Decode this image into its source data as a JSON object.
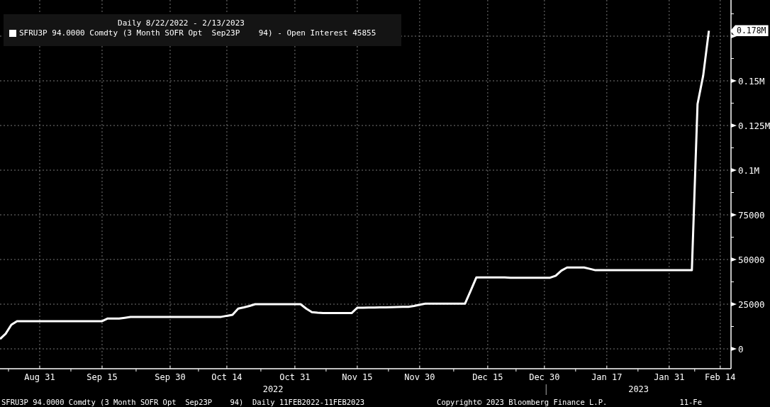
{
  "chart": {
    "chart_data": {
      "type": "line",
      "title": "Daily 8/22/2022 - 2/13/2023",
      "categories": [
        null,
        null,
        null,
        null,
        null,
        null,
        null,
        "Aug 31",
        null,
        null,
        null,
        null,
        null,
        null,
        null,
        null,
        null,
        null,
        "Sep 15",
        null,
        null,
        null,
        null,
        null,
        null,
        null,
        null,
        null,
        null,
        null,
        "Sep 30",
        null,
        null,
        null,
        null,
        null,
        null,
        null,
        null,
        null,
        "Oct 14",
        null,
        null,
        null,
        null,
        null,
        null,
        null,
        null,
        null,
        null,
        null,
        "Oct 31",
        null,
        null,
        null,
        null,
        null,
        null,
        null,
        null,
        null,
        null,
        "Nov 15",
        null,
        null,
        null,
        null,
        null,
        null,
        null,
        null,
        null,
        null,
        "Nov 30",
        null,
        null,
        null,
        null,
        null,
        null,
        null,
        null,
        null,
        null,
        null,
        "Dec 15",
        null,
        null,
        null,
        null,
        null,
        null,
        null,
        null,
        null,
        "Dec 30",
        null,
        null,
        null,
        null,
        null,
        null,
        null,
        null,
        null,
        null,
        "Jan 17",
        null,
        null,
        null,
        null,
        null,
        null,
        null,
        null,
        null,
        null,
        "Jan 31",
        null,
        null,
        null,
        null,
        null,
        null,
        null,
        null,
        "Feb 14"
      ],
      "series": [
        {
          "name": "SFRU3P 94.0000 Comdty (3 Month SOFR Opt  Sep23P    94) - Open Interest 45855",
          "color": "#ffffff",
          "values": [
            5500,
            8500,
            13500,
            15500,
            15500,
            15500,
            15500,
            15500,
            15500,
            15500,
            15500,
            15500,
            15500,
            15500,
            15500,
            15500,
            15500,
            15500,
            15500,
            17000,
            17000,
            17000,
            17400,
            17800,
            17900,
            17900,
            17900,
            17900,
            17900,
            17900,
            17900,
            17900,
            17900,
            17900,
            17900,
            17900,
            17900,
            17900,
            17900,
            17900,
            18500,
            19000,
            22500,
            23200,
            24000,
            25000,
            25000,
            25000,
            25000,
            25000,
            25000,
            25000,
            25000,
            25000,
            22500,
            20500,
            20200,
            20000,
            20000,
            20000,
            20000,
            20000,
            20000,
            23000,
            23000,
            23100,
            23100,
            23200,
            23200,
            23300,
            23400,
            23500,
            23500,
            24000,
            24700,
            25300,
            25300,
            25300,
            25300,
            25300,
            25300,
            25300,
            25300,
            32600,
            40000,
            40000,
            40000,
            40000,
            40000,
            40000,
            39800,
            39800,
            39800,
            39800,
            39800,
            39800,
            39800,
            39800,
            40900,
            43800,
            45500,
            45500,
            45500,
            45500,
            44800,
            44000,
            44000,
            44000,
            44000,
            44000,
            44000,
            44000,
            44000,
            44000,
            44000,
            44000,
            44000,
            44000,
            44000,
            44000,
            44000,
            44000,
            44000,
            137000,
            153000,
            178000,
            null,
            null
          ]
        }
      ],
      "grid": true,
      "ylim": [
        -11111,
        195238
      ],
      "yticks": [
        {
          "value": 0,
          "label": "0"
        },
        {
          "value": 25000,
          "label": "25000"
        },
        {
          "value": 50000,
          "label": "50000"
        },
        {
          "value": 75000,
          "label": "75000"
        },
        {
          "value": 100000,
          "label": "0.1M"
        },
        {
          "value": 125000,
          "label": "0.125M"
        },
        {
          "value": 150000,
          "label": "0.15M"
        }
      ]
    },
    "last_value_tag": "0.178M",
    "year_labels": [
      {
        "label": "2022"
      },
      {
        "label": "2023"
      }
    ]
  },
  "footer": {
    "description": "SFRU3P 94.0000 Comdty (3 Month SOFR Opt  Sep23P    94)  Daily 11FEB2022-11FEB2023",
    "copyright": "Copyright© 2023 Bloomberg Finance L.P.",
    "date": "11-Fe"
  }
}
